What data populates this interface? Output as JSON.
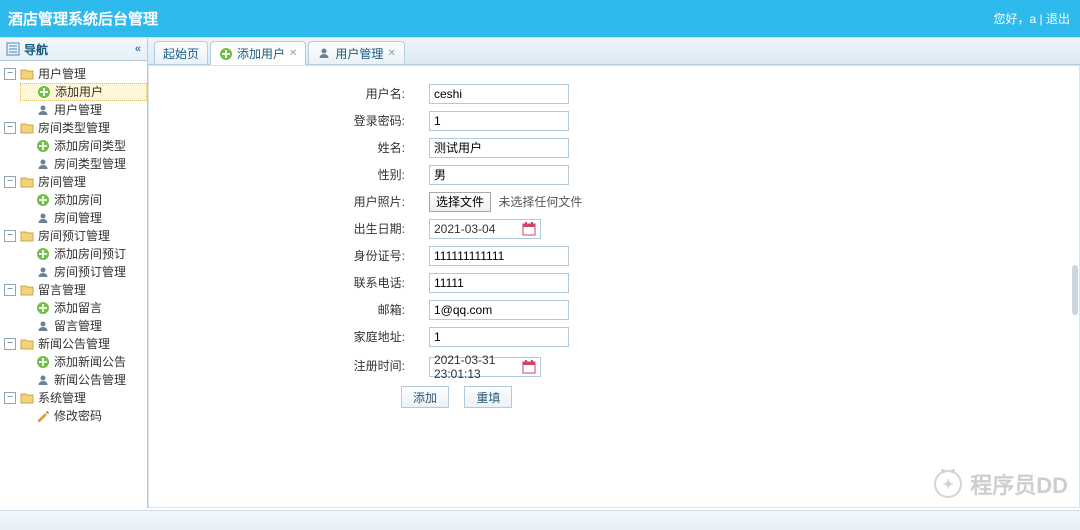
{
  "header": {
    "title": "酒店管理系统后台管理",
    "greeting": "您好，a",
    "logout": "退出"
  },
  "sidebar": {
    "title": "导航",
    "collapse_glyph": "«",
    "groups": [
      {
        "label": "用户管理",
        "children": [
          {
            "label": "添加用户",
            "icon": "add",
            "selected": true
          },
          {
            "label": "用户管理",
            "icon": "user"
          }
        ]
      },
      {
        "label": "房间类型管理",
        "children": [
          {
            "label": "添加房间类型",
            "icon": "add"
          },
          {
            "label": "房间类型管理",
            "icon": "user"
          }
        ]
      },
      {
        "label": "房间管理",
        "children": [
          {
            "label": "添加房间",
            "icon": "add"
          },
          {
            "label": "房间管理",
            "icon": "user"
          }
        ]
      },
      {
        "label": "房间预订管理",
        "children": [
          {
            "label": "添加房间预订",
            "icon": "add"
          },
          {
            "label": "房间预订管理",
            "icon": "user"
          }
        ]
      },
      {
        "label": "留言管理",
        "children": [
          {
            "label": "添加留言",
            "icon": "add"
          },
          {
            "label": "留言管理",
            "icon": "user"
          }
        ]
      },
      {
        "label": "新闻公告管理",
        "children": [
          {
            "label": "添加新闻公告",
            "icon": "add"
          },
          {
            "label": "新闻公告管理",
            "icon": "user"
          }
        ]
      },
      {
        "label": "系统管理",
        "children": [
          {
            "label": "修改密码",
            "icon": "edit"
          }
        ]
      }
    ]
  },
  "tabs": [
    {
      "label": "起始页",
      "icon": null,
      "closable": false,
      "active": false
    },
    {
      "label": "添加用户",
      "icon": "add",
      "closable": true,
      "active": true
    },
    {
      "label": "用户管理",
      "icon": "user",
      "closable": true,
      "active": false
    }
  ],
  "form": {
    "fields": {
      "username": {
        "label": "用户名:",
        "value": "ceshi"
      },
      "password": {
        "label": "登录密码:",
        "value": "1"
      },
      "realname": {
        "label": "姓名:",
        "value": "测试用户"
      },
      "gender": {
        "label": "性别:",
        "value": "男"
      },
      "photo": {
        "label": "用户照片:",
        "button": "选择文件",
        "status": "未选择任何文件"
      },
      "birthday": {
        "label": "出生日期:",
        "value": "2021-03-04"
      },
      "idcard": {
        "label": "身份证号:",
        "value": "111111111111"
      },
      "phone": {
        "label": "联系电话:",
        "value": "11111"
      },
      "email": {
        "label": "邮箱:",
        "value": "1@qq.com"
      },
      "address": {
        "label": "家庭地址:",
        "value": "1"
      },
      "regtime": {
        "label": "注册时间:",
        "value": "2021-03-31 23:01:13"
      }
    },
    "buttons": {
      "submit": "添加",
      "reset": "重填"
    }
  },
  "watermark": "程序员DD"
}
